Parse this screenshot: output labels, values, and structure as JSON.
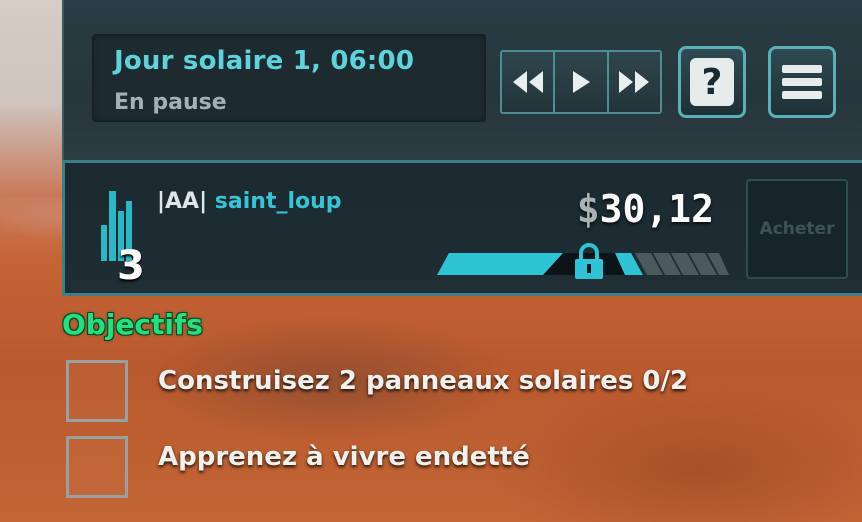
{
  "time_panel": {
    "date": "Jour solaire 1, 06:00",
    "status": "En pause",
    "speed_buttons": [
      {
        "name": "rewind",
        "glyph": "⏪"
      },
      {
        "name": "play",
        "glyph": "▶"
      },
      {
        "name": "fast-forward",
        "glyph": "⏩"
      }
    ],
    "help_glyph": "?"
  },
  "player": {
    "rank": "3",
    "tag": "|AA|",
    "username": "saint_loup",
    "money_sign": "$",
    "money_value": "30,12",
    "credit_progress": 0.55,
    "buy_label": "Acheter"
  },
  "objectives": {
    "title": "Objectifs",
    "items": [
      {
        "text": "Construisez 2 panneaux solaires 0/2",
        "done": false
      },
      {
        "text": "Apprenez à vivre endetté",
        "done": false
      }
    ]
  },
  "colors": {
    "accent_cyan": "#37c4d4",
    "objective_green": "#23e07e",
    "panel_dark": "#1e2e34"
  }
}
